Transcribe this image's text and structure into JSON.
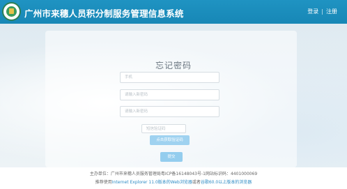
{
  "header": {
    "title": "广州市来穗人员积分制服务管理信息系统",
    "login": "登录",
    "separator": "|",
    "register": "注册"
  },
  "form": {
    "title": "忘记密码",
    "phone_placeholder": "手机",
    "new_password_placeholder": "请输入新密码",
    "confirm_password_placeholder": "请输入新密码",
    "sms_code_placeholder": "短信验证码",
    "get_code_button": "点击获取验证码",
    "submit_button": "提交"
  },
  "footer": {
    "line1": "主办单位：广州市来穗人员服务管理局粤ICP备16148043号-1网站标识码：4401000069",
    "line2_prefix": "推荐使用",
    "line2_link1": "Internet Explorer 11.0版本的Web浏览器",
    "line2_mid": "或者",
    "line2_link2": "谷歌60.0以上版本的浏览器"
  },
  "colors": {
    "header": "#1787b6",
    "button": "#94cdee",
    "link": "#2d8bc4"
  }
}
